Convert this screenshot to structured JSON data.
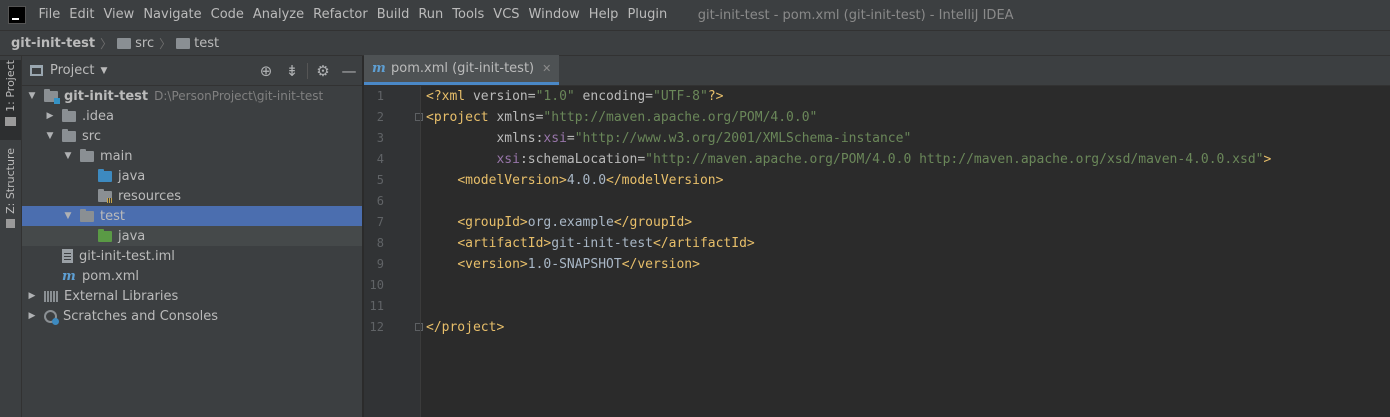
{
  "menubar": {
    "items": [
      "File",
      "Edit",
      "View",
      "Navigate",
      "Code",
      "Analyze",
      "Refactor",
      "Build",
      "Run",
      "Tools",
      "VCS",
      "Window",
      "Help",
      "Plugin"
    ],
    "window_title": "git-init-test - pom.xml (git-init-test) - IntelliJ IDEA"
  },
  "navbar": {
    "project": "git-init-test",
    "crumbs": [
      "src",
      "test"
    ]
  },
  "tool_stripe": {
    "project_tab": "1: Project",
    "structure_tab": "Z: Structure"
  },
  "project_panel": {
    "title": "Project",
    "tree": [
      {
        "label": "git-init-test",
        "hint": "D:\\PersonProject\\git-init-test"
      },
      {
        "label": ".idea"
      },
      {
        "label": "src"
      },
      {
        "label": "main"
      },
      {
        "label": "java"
      },
      {
        "label": "resources"
      },
      {
        "label": "test"
      },
      {
        "label": "java"
      },
      {
        "label": "git-init-test.iml"
      },
      {
        "label": "pom.xml"
      },
      {
        "label": "External Libraries"
      },
      {
        "label": "Scratches and Consoles"
      }
    ]
  },
  "editor": {
    "tab_label": "pom.xml (git-init-test)",
    "line_numbers": [
      "1",
      "2",
      "3",
      "4",
      "5",
      "6",
      "7",
      "8",
      "9",
      "10",
      "11",
      "12"
    ],
    "code": {
      "xml_decl_open": "<?xml ",
      "version_attr": "version=",
      "version_val": "\"1.0\"",
      "encoding_attr": " encoding=",
      "encoding_val": "\"UTF-8\"",
      "xml_decl_close": "?>",
      "project_open": "<project",
      "xmlns_attr": " xmlns=",
      "xmlns_val": "\"http://maven.apache.org/POM/4.0.0\"",
      "xsi_prefix": "xmlns:",
      "xsi_name": "xsi",
      "xsi_eq": "=",
      "xsi_val": "\"http://www.w3.org/2001/XMLSchema-instance\"",
      "schema_prefix": "xsi",
      "schema_attr": ":schemaLocation=",
      "schema_val": "\"http://maven.apache.org/POM/4.0.0 http://maven.apache.org/xsd/maven-4.0.0.xsd\"",
      "gt": ">",
      "model_open": "<modelVersion>",
      "model_val": "4.0.0",
      "model_close": "</modelVersion>",
      "group_open": "<groupId>",
      "group_val": "org.example",
      "group_close": "</groupId>",
      "artifact_open": "<artifactId>",
      "artifact_val": "git-init-test",
      "artifact_close": "</artifactId>",
      "ver_open": "<version>",
      "ver_val": "1.0-SNAPSHOT",
      "ver_close": "</version>",
      "project_close": "</project>"
    }
  }
}
